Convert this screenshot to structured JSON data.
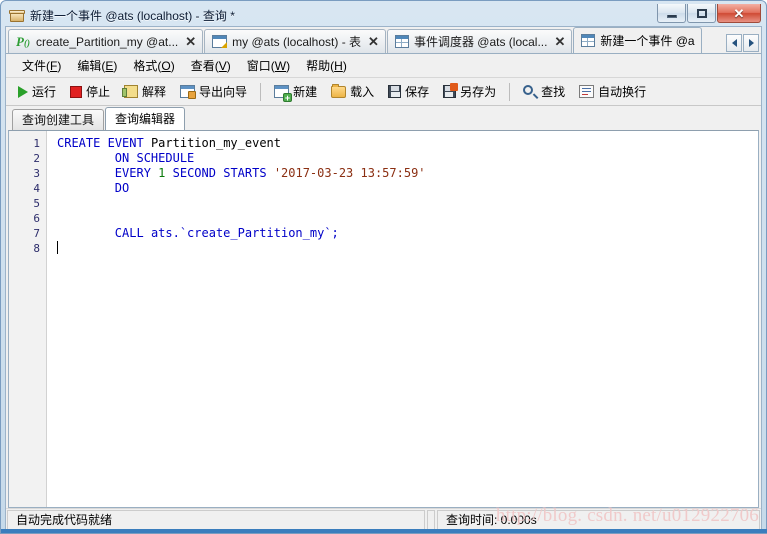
{
  "window": {
    "title": "新建一个事件 @ats (localhost) - 查询 *",
    "icon": "event-window-icon",
    "buttons": {
      "minimize": "—",
      "maximize": "❐",
      "close": "✕"
    }
  },
  "doc_tabs": [
    {
      "label": "create_Partition_my @at...",
      "icon": "procedure-icon",
      "close": "✕",
      "active": false
    },
    {
      "label": "my @ats (localhost) - 表",
      "icon": "table-edit-icon",
      "close": "✕",
      "active": false
    },
    {
      "label": "事件调度器 @ats (local...",
      "icon": "grid-icon",
      "close": "✕",
      "active": false
    },
    {
      "label": "新建一个事件 @a",
      "icon": "grid-icon",
      "close": "",
      "active": true
    }
  ],
  "tab_scroll": {
    "prev": "◀",
    "next": "▶"
  },
  "menu": [
    {
      "label": "文件",
      "accel": "F"
    },
    {
      "label": "编辑",
      "accel": "E"
    },
    {
      "label": "格式",
      "accel": "O"
    },
    {
      "label": "查看",
      "accel": "V"
    },
    {
      "label": "窗口",
      "accel": "W"
    },
    {
      "label": "帮助",
      "accel": "H"
    }
  ],
  "toolbar": [
    {
      "label": "运行",
      "icon": "play-icon"
    },
    {
      "label": "停止",
      "icon": "stop-icon"
    },
    {
      "label": "解释",
      "icon": "explain-icon"
    },
    {
      "label": "导出向导",
      "icon": "export-wizard-icon"
    },
    {
      "label": "新建",
      "icon": "new-query-icon"
    },
    {
      "label": "载入",
      "icon": "folder-open-icon"
    },
    {
      "label": "保存",
      "icon": "save-icon"
    },
    {
      "label": "另存为",
      "icon": "save-as-icon"
    },
    {
      "label": "查找",
      "icon": "search-icon"
    },
    {
      "label": "自动换行",
      "icon": "word-wrap-icon"
    }
  ],
  "sub_tabs": [
    {
      "label": "查询创建工具",
      "active": false
    },
    {
      "label": "查询编辑器",
      "active": true
    }
  ],
  "editor": {
    "line_numbers": [
      "1",
      "2",
      "3",
      "4",
      "5",
      "6",
      "7",
      "8"
    ],
    "lines": [
      {
        "n": 1,
        "tokens": [
          {
            "t": "CREATE",
            "c": "kw"
          },
          {
            "t": " ",
            "c": "idf"
          },
          {
            "t": "EVENT",
            "c": "kw"
          },
          {
            "t": " ",
            "c": "idf"
          },
          {
            "t": "Partition_my_event",
            "c": "idf"
          }
        ]
      },
      {
        "n": 2,
        "tokens": [
          {
            "t": "        ",
            "c": "idf"
          },
          {
            "t": "ON",
            "c": "kw"
          },
          {
            "t": " ",
            "c": "idf"
          },
          {
            "t": "SCHEDULE",
            "c": "kw"
          }
        ]
      },
      {
        "n": 3,
        "tokens": [
          {
            "t": "        ",
            "c": "idf"
          },
          {
            "t": "EVERY",
            "c": "kw"
          },
          {
            "t": " ",
            "c": "idf"
          },
          {
            "t": "1",
            "c": "num"
          },
          {
            "t": " ",
            "c": "idf"
          },
          {
            "t": "SECOND",
            "c": "kw"
          },
          {
            "t": " ",
            "c": "idf"
          },
          {
            "t": "STARTS",
            "c": "kw"
          },
          {
            "t": " ",
            "c": "idf"
          },
          {
            "t": "'2017-03-23 13:57:59'",
            "c": "str"
          }
        ]
      },
      {
        "n": 4,
        "tokens": [
          {
            "t": "        ",
            "c": "idf"
          },
          {
            "t": "DO",
            "c": "kw"
          }
        ]
      },
      {
        "n": 5,
        "tokens": []
      },
      {
        "n": 6,
        "tokens": []
      },
      {
        "n": 7,
        "tokens": [
          {
            "t": "        ",
            "c": "idf"
          },
          {
            "t": "CALL",
            "c": "kw"
          },
          {
            "t": " ",
            "c": "idf"
          },
          {
            "t": "ats.`create_Partition_my`;",
            "c": "kw"
          }
        ]
      },
      {
        "n": 8,
        "tokens": [],
        "caret": true
      }
    ]
  },
  "status": {
    "left": "自动完成代码就绪",
    "right": "查询时间: 0.000s"
  },
  "watermark": "http://blog. csdn. net/u012922706",
  "colors": {
    "keyword": "#0000c8",
    "number": "#0a7a0a",
    "string": "#8b2f12",
    "accent": "#3a7dbd"
  }
}
